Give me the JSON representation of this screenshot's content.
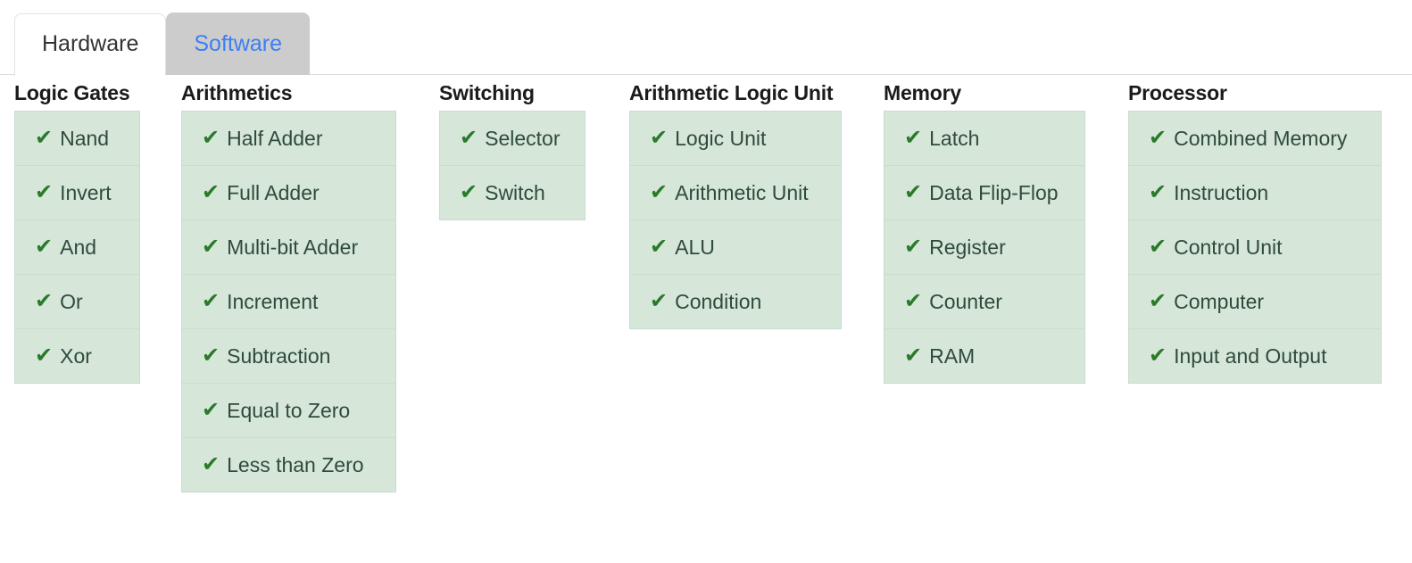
{
  "tabs": [
    {
      "label": "Hardware",
      "active": true
    },
    {
      "label": "Software",
      "active": false
    }
  ],
  "colors": {
    "item_background": "#d6e7da",
    "item_border": "#cadcce",
    "check_green": "#2a7a2a",
    "item_text": "#2f4b3a",
    "inactive_tab_background": "#cccccc",
    "inactive_tab_text": "#3b7ff5",
    "active_tab_background": "#ffffff",
    "divider": "#dddddd"
  },
  "check_glyph": "✔",
  "columns": [
    {
      "title": "Logic Gates",
      "items": [
        "Nand",
        "Invert",
        "And",
        "Or",
        "Xor"
      ]
    },
    {
      "title": "Arithmetics",
      "items": [
        "Half Adder",
        "Full Adder",
        "Multi-bit Adder",
        "Increment",
        "Subtraction",
        "Equal to Zero",
        "Less than Zero"
      ]
    },
    {
      "title": "Switching",
      "items": [
        "Selector",
        "Switch"
      ]
    },
    {
      "title": "Arithmetic Logic Unit",
      "items": [
        "Logic Unit",
        "Arithmetic Unit",
        "ALU",
        "Condition"
      ]
    },
    {
      "title": "Memory",
      "items": [
        "Latch",
        "Data Flip-Flop",
        "Register",
        "Counter",
        "RAM"
      ]
    },
    {
      "title": "Processor",
      "items": [
        "Combined Memory",
        "Instruction",
        "Control Unit",
        "Computer",
        "Input and Output"
      ]
    }
  ]
}
